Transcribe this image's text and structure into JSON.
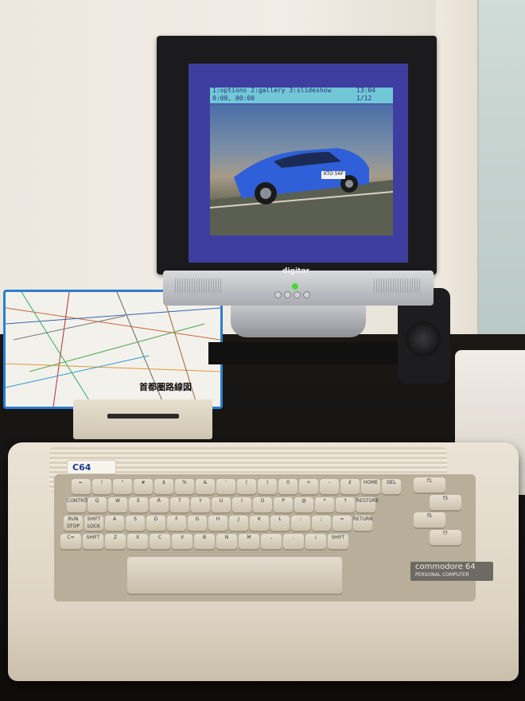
{
  "screen": {
    "status_left_line1": "1:options 2:gallery 3:slideshow",
    "status_left_line2": "0:00, 00:00",
    "status_right_line1": "13:04",
    "status_right_line2": "1/12",
    "car_plate": "KTO 56F",
    "bar_color": "#72c7d7",
    "screen_color": "#3e3ea0"
  },
  "monitor": {
    "brand": "digitor"
  },
  "map": {
    "title": "首都圏路線図"
  },
  "c64": {
    "logo": "C64",
    "badge_line1": "commodore 64",
    "badge_line2": "PERSONAL COMPUTER",
    "keys": [
      "←",
      "!",
      "\"",
      "#",
      "$",
      "%",
      "&",
      "'",
      "(",
      ")",
      "0",
      "+",
      "-",
      "£",
      "HOME",
      "DEL",
      "CONTROL",
      "Q",
      "W",
      "E",
      "R",
      "T",
      "Y",
      "U",
      "I",
      "O",
      "P",
      "@",
      "*",
      "↑",
      "RESTORE",
      "RUN STOP",
      "SHIFT LOCK",
      "A",
      "S",
      "D",
      "F",
      "G",
      "H",
      "J",
      "K",
      "L",
      ":",
      ";",
      "=",
      "RETURN",
      "C=",
      "SHIFT",
      "Z",
      "X",
      "C",
      "V",
      "B",
      "N",
      "M",
      ",",
      ".",
      "/",
      "SHIFT",
      "f1",
      "f3",
      "f5",
      "f7"
    ]
  }
}
